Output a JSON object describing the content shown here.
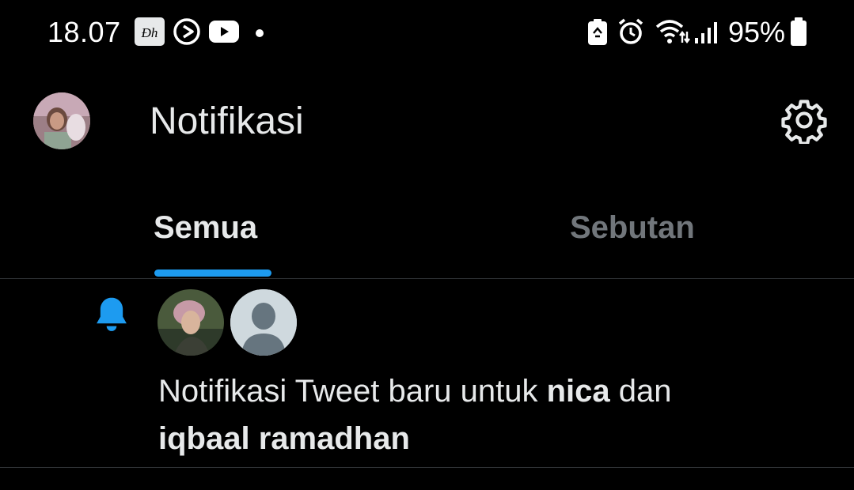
{
  "status_bar": {
    "time": "18.07",
    "battery_percent": "95%",
    "icons": [
      "disney-hotstar-icon",
      "play-circle-icon",
      "youtube-icon",
      "dot-icon",
      "battery-saver-icon",
      "alarm-icon",
      "wifi-icon",
      "signal-icon",
      "battery-icon"
    ]
  },
  "header": {
    "title": "Notifikasi",
    "settings_icon": "gear-icon"
  },
  "tabs": {
    "all": "Semua",
    "mentions": "Sebutan",
    "active": "Semua"
  },
  "notification": {
    "icon": "bell-icon",
    "text_prefix": "Notifikasi Tweet baru untuk ",
    "user1": "nica",
    "conjunction": " dan",
    "user2": "iqbaal ramadhan"
  },
  "colors": {
    "background": "#000000",
    "accent": "#1d9bf0",
    "text_primary": "#e7e9ea",
    "text_secondary": "#71767b",
    "divider": "#2f3336"
  }
}
